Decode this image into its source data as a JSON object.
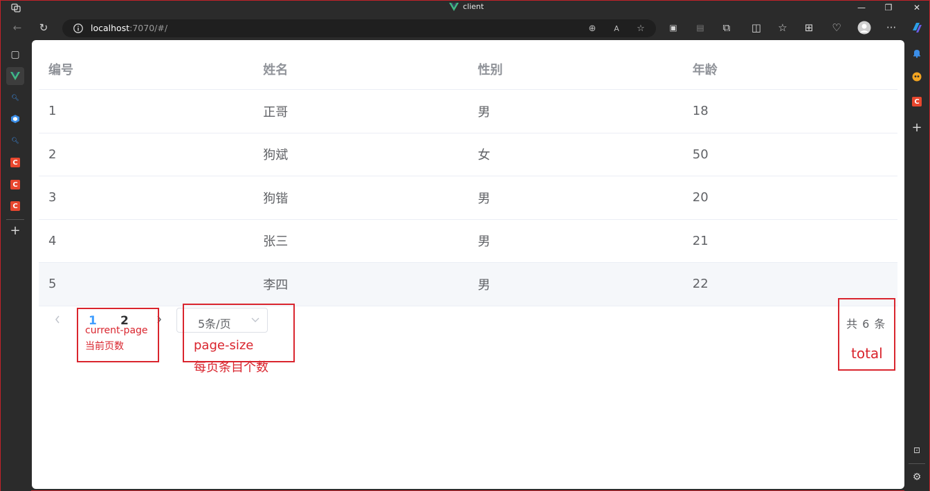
{
  "browser": {
    "tab_title": "client",
    "url_host": "localhost",
    "url_rest": ":7070/#/"
  },
  "table": {
    "headers": [
      "编号",
      "姓名",
      "性别",
      "年龄"
    ],
    "rows": [
      [
        "1",
        "正哥",
        "男",
        "18"
      ],
      [
        "2",
        "狗斌",
        "女",
        "50"
      ],
      [
        "3",
        "狗锴",
        "男",
        "20"
      ],
      [
        "4",
        "张三",
        "男",
        "21"
      ],
      [
        "5",
        "李四",
        "男",
        "22"
      ]
    ]
  },
  "pagination": {
    "pages": [
      "1",
      "2"
    ],
    "current_page": 1,
    "page_size_label": "5条/页",
    "total_label": "共 6 条"
  },
  "annotations": {
    "current_page_en": "current-page",
    "current_page_zh": "当前页数",
    "page_size_en": "page-size",
    "page_size_zh": "每页条目个数",
    "total": "total"
  },
  "colors": {
    "accent": "#409eff",
    "annotation": "#d9242d",
    "vue_green": "#41b883"
  }
}
